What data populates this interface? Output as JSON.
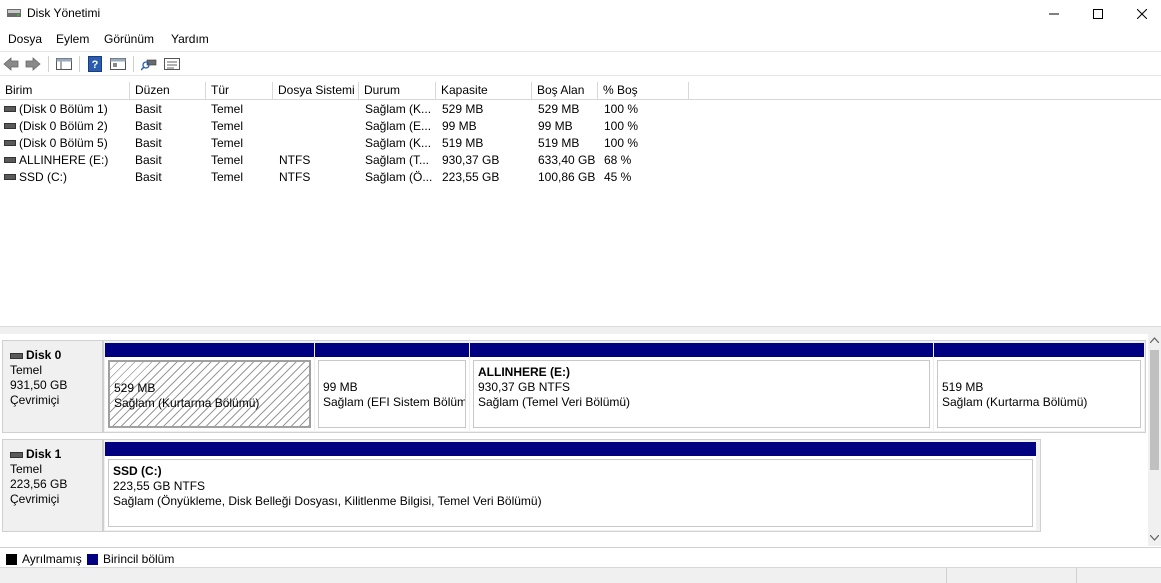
{
  "window": {
    "title": "Disk Yönetimi",
    "controls": {
      "minimize": "—",
      "maximize": "☐",
      "close": "✕"
    }
  },
  "menu": [
    "Dosya",
    "Eylem",
    "Görünüm",
    "Yardım"
  ],
  "toolbar": {
    "icons": [
      "back-icon",
      "forward-icon",
      "console-tree-icon",
      "help-icon",
      "properties-icon",
      "rescan-icon",
      "settings-list-icon"
    ]
  },
  "table": {
    "columns": [
      "Birim",
      "Düzen",
      "Tür",
      "Dosya Sistemi",
      "Durum",
      "Kapasite",
      "Boş Alan",
      "% Boş"
    ],
    "rows": [
      [
        "(Disk 0 Bölüm 1)",
        "Basit",
        "Temel",
        "",
        "Sağlam (K...",
        "529 MB",
        "529 MB",
        "100 %"
      ],
      [
        "(Disk 0 Bölüm 2)",
        "Basit",
        "Temel",
        "",
        "Sağlam (E...",
        "99 MB",
        "99 MB",
        "100 %"
      ],
      [
        "(Disk 0 Bölüm 5)",
        "Basit",
        "Temel",
        "",
        "Sağlam (K...",
        "519 MB",
        "519 MB",
        "100 %"
      ],
      [
        "ALLINHERE (E:)",
        "Basit",
        "Temel",
        "NTFS",
        "Sağlam (T...",
        "930,37 GB",
        "633,40 GB",
        "68 %"
      ],
      [
        "SSD (C:)",
        "Basit",
        "Temel",
        "NTFS",
        "Sağlam (Ö...",
        "223,55 GB",
        "100,86 GB",
        "45 %"
      ]
    ]
  },
  "disks": [
    {
      "name": "Disk 0",
      "type": "Temel",
      "size": "931,50 GB",
      "status": "Çevrimiçi",
      "partitions": [
        {
          "name": "",
          "size": "529 MB",
          "status": "Sağlam (Kurtarma Bölümü)"
        },
        {
          "name": "",
          "size": "99 MB",
          "status": "Sağlam (EFI Sistem Bölümü)"
        },
        {
          "name": "ALLINHERE  (E:)",
          "size": "930,37 GB NTFS",
          "status": "Sağlam (Temel Veri Bölümü)"
        },
        {
          "name": "",
          "size": "519 MB",
          "status": "Sağlam (Kurtarma Bölümü)"
        }
      ]
    },
    {
      "name": "Disk 1",
      "type": "Temel",
      "size": "223,56 GB",
      "status": "Çevrimiçi",
      "partitions": [
        {
          "name": "SSD  (C:)",
          "size": "223,55 GB NTFS",
          "status": "Sağlam (Önyükleme, Disk Belleği Dosyası, Kilitlenme Bilgisi, Temel Veri Bölümü)"
        }
      ]
    }
  ],
  "legend": [
    {
      "label": "Ayrılmamış",
      "color": "#000000"
    },
    {
      "label": "Birincil bölüm",
      "color": "#000080"
    }
  ],
  "colors": {
    "primary_partition": "#000080",
    "unallocated": "#000000"
  }
}
